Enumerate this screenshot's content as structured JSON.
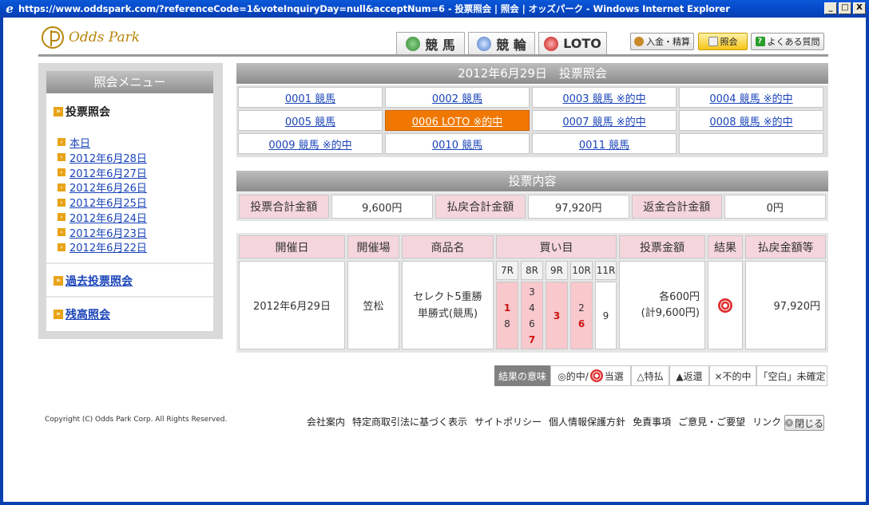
{
  "window": {
    "title": "https://www.oddspark.com/?referenceCode=1&voteInquiryDay=null&acceptNum=6 - 投票照会 | 照会 | オッズパーク - Windows Internet Explorer",
    "minimize": "_",
    "maximize": "□",
    "close": "X"
  },
  "header": {
    "logo_text": "Odds Park",
    "tabs": [
      {
        "label": "競 馬"
      },
      {
        "label": "競 輪"
      },
      {
        "label": "LOTO"
      }
    ],
    "buttons": {
      "deposit": "入金・精算",
      "inquiry": "照会",
      "faq": "よくある質問"
    }
  },
  "sidebar": {
    "title": "照会メニュー",
    "heading": "投票照会",
    "links": [
      "本日",
      "2012年6月28日",
      "2012年6月27日",
      "2012年6月26日",
      "2012年6月25日",
      "2012年6月24日",
      "2012年6月23日",
      "2012年6月22日"
    ],
    "past_inquiry": "過去投票照会",
    "balance_inquiry": "残高照会"
  },
  "main": {
    "date_title": "2012年6月29日　投票照会",
    "votes": [
      {
        "label": "0001 競馬",
        "active": false
      },
      {
        "label": "0002 競馬",
        "active": false
      },
      {
        "label": "0003 競馬 ※的中",
        "active": false
      },
      {
        "label": "0004 競馬 ※的中",
        "active": false
      },
      {
        "label": "0005 競馬",
        "active": false
      },
      {
        "label": "0006 LOTO ※的中",
        "active": true
      },
      {
        "label": "0007 競馬 ※的中",
        "active": false
      },
      {
        "label": "0008 競馬 ※的中",
        "active": false
      },
      {
        "label": "0009 競馬 ※的中",
        "active": false
      },
      {
        "label": "0010 競馬",
        "active": false
      },
      {
        "label": "0011 競馬",
        "active": false
      }
    ],
    "content_title": "投票内容",
    "summary": {
      "total_bet_label": "投票合計金額",
      "total_bet_value": "9,600円",
      "total_payout_label": "払戻合計金額",
      "total_payout_value": "97,920円",
      "total_refund_label": "返金合計金額",
      "total_refund_value": "0円"
    },
    "detail": {
      "headers": {
        "date": "開催日",
        "venue": "開催場",
        "product": "商品名",
        "selection": "買い目",
        "bet_amount": "投票金額",
        "result": "結果",
        "payout": "払戻金額等"
      },
      "races": [
        "7R",
        "8R",
        "9R",
        "10R",
        "11R"
      ],
      "row": {
        "date": "2012年6月29日",
        "venue": "笠松",
        "product_line1": "セレクト5重勝",
        "product_line2": "単勝式(競馬)",
        "race_picks": [
          [
            {
              "n": "1",
              "hit": true
            },
            {
              "n": "8",
              "hit": false
            }
          ],
          [
            {
              "n": "3",
              "hit": false
            },
            {
              "n": "4",
              "hit": false
            },
            {
              "n": "6",
              "hit": false
            },
            {
              "n": "7",
              "hit": true
            }
          ],
          [
            {
              "n": "3",
              "hit": true
            }
          ],
          [
            {
              "n": "2",
              "hit": false
            },
            {
              "n": "6",
              "hit": true
            }
          ],
          [
            {
              "n": "9",
              "hit": false
            }
          ]
        ],
        "bet_amount_line1": "各600円",
        "bet_amount_line2": "(計9,600円)",
        "payout": "97,920円"
      }
    },
    "legend": {
      "title": "結果の意味",
      "hit": "◎的中/",
      "win": "当選",
      "special": "△特払",
      "refund": "▲返還",
      "miss": "×不的中",
      "pending": "「空白」未確定"
    }
  },
  "footer": {
    "copyright": "Copyright (C) Odds Park Corp. All Rights Reserved.",
    "links": [
      "会社案内",
      "特定商取引法に基づく表示",
      "サイトポリシー",
      "個人情報保護方針",
      "免責事項",
      "ご意見・ご要望",
      "リンク"
    ],
    "close": "閉じる"
  }
}
